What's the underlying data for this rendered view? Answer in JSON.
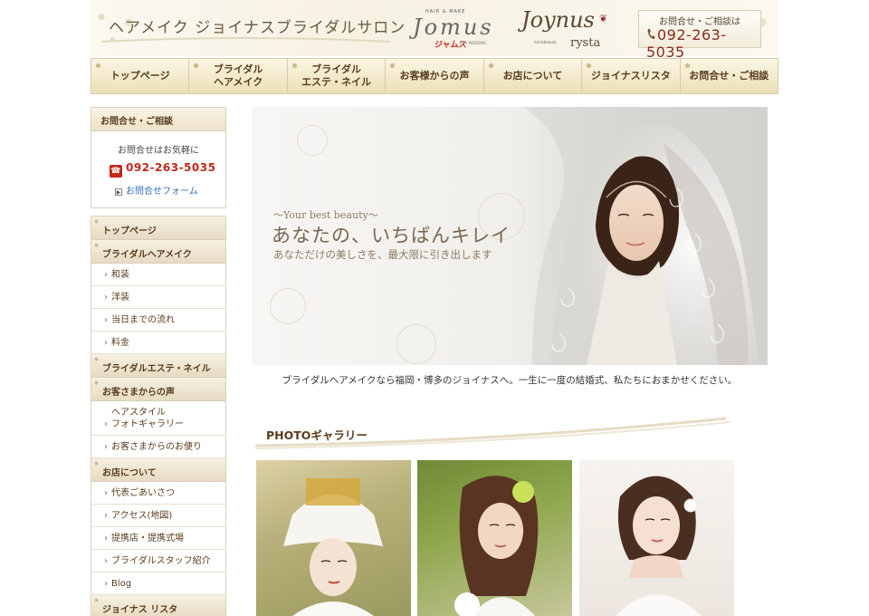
{
  "header": {
    "site_title": "ヘアメイク ジョイナスブライダルサロン",
    "logo_jamus": {
      "top_text": "HAIR & MAKE",
      "script_text": "Jomus",
      "katakana": "ジャムス",
      "bottom_text": "FOR WEDDING"
    },
    "logo_joynus": {
      "script_text": "Joynus",
      "tagline": "hair&beauty",
      "brand": "rysta"
    },
    "contact": {
      "label": "お問合せ・ご相談は",
      "phone": "092-263-5035"
    }
  },
  "nav": [
    {
      "label": "トップページ"
    },
    {
      "label": "ブライダル\nヘアメイク"
    },
    {
      "label": "ブライダル\nエステ・ネイル"
    },
    {
      "label": "お客様からの声"
    },
    {
      "label": "お店について"
    },
    {
      "label": "ジョイナスリスタ"
    },
    {
      "label": "お問合せ・ご相談"
    }
  ],
  "sidebar": {
    "contact": {
      "heading": "お問合せ・ご相談",
      "message": "お問合せはお気軽に",
      "phone": "092-263-5035",
      "form_link": "お問合せフォーム"
    },
    "menu": [
      {
        "type": "cat",
        "label": "トップページ"
      },
      {
        "type": "cat",
        "label": "ブライダルヘアメイク"
      },
      {
        "type": "sub",
        "label": "和装"
      },
      {
        "type": "sub",
        "label": "洋装"
      },
      {
        "type": "sub",
        "label": "当日までの流れ"
      },
      {
        "type": "sub",
        "label": "料金"
      },
      {
        "type": "cat",
        "label": "ブライダルエステ・ネイル"
      },
      {
        "type": "cat",
        "label": "お客さまからの声"
      },
      {
        "type": "sub",
        "label": "ヘアスタイル\nフォトギャラリー"
      },
      {
        "type": "sub",
        "label": "お客さまからのお便り"
      },
      {
        "type": "cat",
        "label": "お店について"
      },
      {
        "type": "sub",
        "label": "代表ごあいさつ"
      },
      {
        "type": "sub",
        "label": "アクセス(地図)"
      },
      {
        "type": "sub",
        "label": "提携店・提携式場"
      },
      {
        "type": "sub",
        "label": "ブライダルスタッフ紹介"
      },
      {
        "type": "sub",
        "label": "Blog"
      },
      {
        "type": "cat",
        "label": "ジョイナス リスタ"
      }
    ]
  },
  "hero": {
    "tagline": "〜Your best beauty〜",
    "headline": "あなたの、いちばんキレイ",
    "subhead": "あなただけの美しさを、最大限に引き出します"
  },
  "intro": "ブライダルヘアメイクなら福岡・博多のジョイナスへ。一生に一度の結婚式、私たちにおまかせください。",
  "gallery": {
    "heading": "PHOTOギャラリー"
  },
  "colors": {
    "accent_brown": "#5a3c1e",
    "phone_red": "#c0281a",
    "link_blue": "#3a6eb5",
    "nav_gold": "#ece0b8"
  }
}
